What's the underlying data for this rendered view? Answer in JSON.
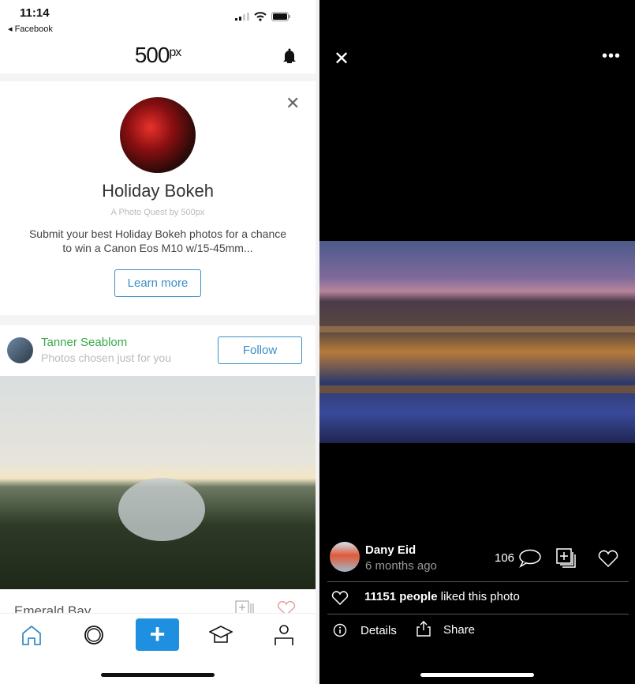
{
  "status_bar": {
    "time": "11:14",
    "back_label": "Facebook"
  },
  "header": {
    "logo": "500",
    "logo_sup": "px"
  },
  "quest": {
    "title": "Holiday Bokeh",
    "subtitle": "A Photo Quest by 500px",
    "description": "Submit your best Holiday Bokeh photos for a chance to win a Canon Eos M10 w/15-45mm...",
    "button": "Learn more"
  },
  "suggestion": {
    "name": "Tanner Seablom",
    "subtitle": "Photos chosen just for you",
    "button": "Follow"
  },
  "feed_photo": {
    "title": "Emerald Bay"
  },
  "tabbar": {
    "items": [
      "home",
      "discover",
      "upload",
      "learn",
      "profile"
    ],
    "accent": "#1e90df"
  },
  "viewer": {
    "author": "Dany Eid",
    "time_ago": "6 months ago",
    "comments": "106",
    "likes_count": "11151 people",
    "likes_suffix": " liked this photo",
    "details": "Details",
    "share": "Share"
  }
}
